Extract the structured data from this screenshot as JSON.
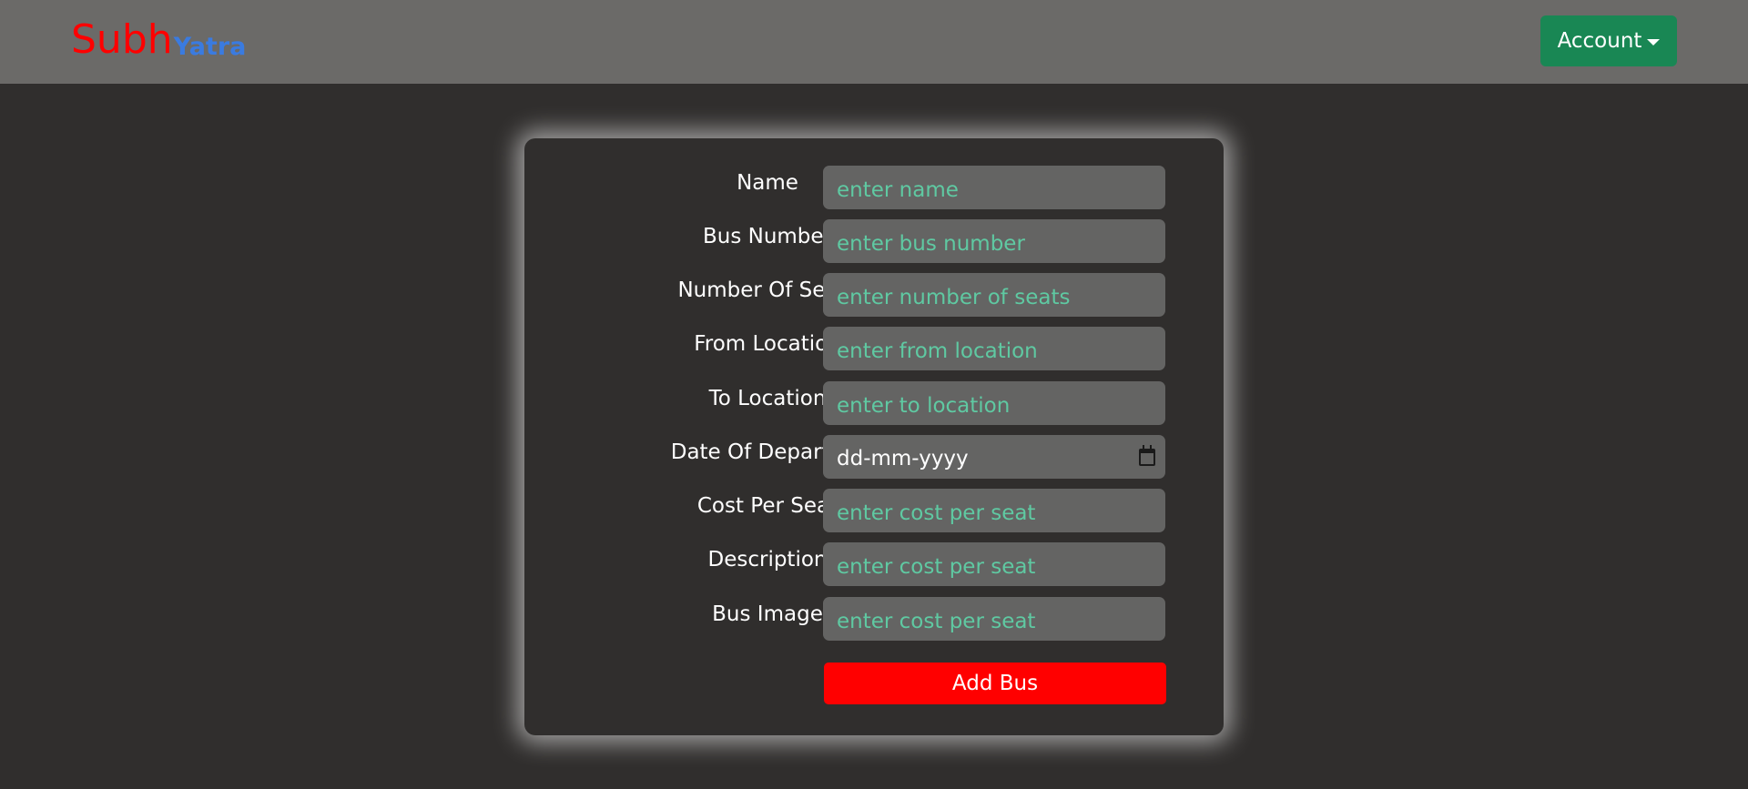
{
  "navbar": {
    "brand_primary": "Subh",
    "brand_secondary": "Yatra",
    "account_label": "Account"
  },
  "form": {
    "fields": [
      {
        "label": "Name",
        "placeholder": "enter name"
      },
      {
        "label": "Bus Number",
        "placeholder": "enter bus number"
      },
      {
        "label": "Number Of Seats",
        "placeholder": "enter number of seats"
      },
      {
        "label": "From Location",
        "placeholder": "enter from location"
      },
      {
        "label": "To Location",
        "placeholder": "enter to location"
      },
      {
        "label": "Date Of Departure",
        "value": "dd-mm-yyyy"
      },
      {
        "label": "Cost Per Seat",
        "placeholder": "enter cost per seat"
      },
      {
        "label": "Description",
        "placeholder": "enter cost per seat"
      },
      {
        "label": "Bus Image",
        "placeholder": "enter cost per seat"
      }
    ],
    "submit_label": "Add Bus"
  },
  "colors": {
    "navbar_bg": "#6b6a68",
    "page_bg": "#302e2d",
    "brand_primary": "#ff0000",
    "brand_secondary": "#3a7be0",
    "account_button": "#198754",
    "input_bg": "#646463",
    "placeholder_text": "#5fc9a2",
    "submit_button": "#ff0000"
  },
  "icons": {
    "account_caret": "chevron-down-icon",
    "date_picker": "calendar-icon"
  }
}
